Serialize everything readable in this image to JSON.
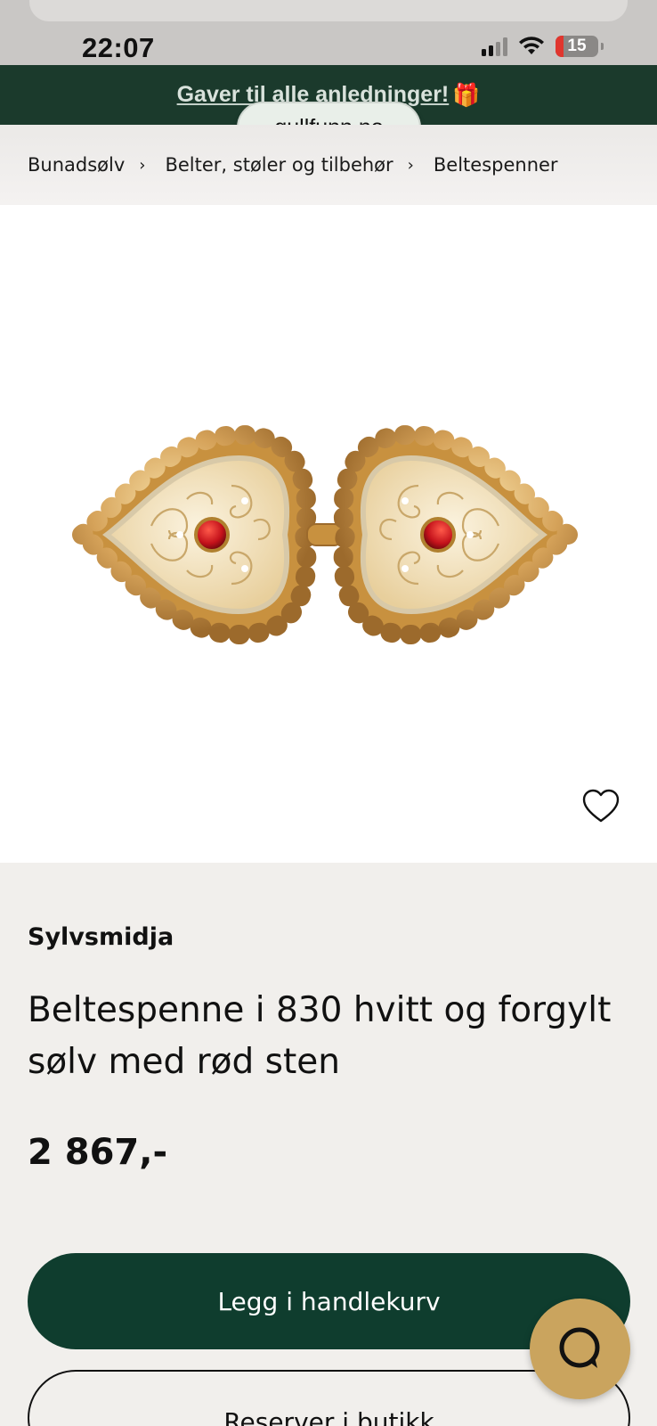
{
  "status_bar": {
    "time": "22:07",
    "battery": "15"
  },
  "promo": {
    "text": "Gaver til alle anledninger!",
    "emoji": "🎁"
  },
  "browser": {
    "domain": "gullfunn.no"
  },
  "breadcrumb": [
    {
      "label": "Bunadsølv"
    },
    {
      "label": "Belter, støler og tilbehør"
    },
    {
      "label": "Beltespenner"
    }
  ],
  "product": {
    "brand": "Sylvsmidja",
    "title": "Beltespenne i 830 hvitt og forgylt sølv med rød sten",
    "price": "2 867,-"
  },
  "actions": {
    "add_to_cart": "Legg i handlekurv",
    "reserve": "Reserver i butikk"
  },
  "colors": {
    "promo_bg": "#1b3a2c",
    "primary_button": "#0f3d2e",
    "chat_button": "#caa45e",
    "page_bg": "#f1efec"
  },
  "icons": {
    "favorite": "heart-outline-icon",
    "chat": "chat-bubble-icon",
    "breadcrumb_separator": "chevron-right-icon"
  }
}
